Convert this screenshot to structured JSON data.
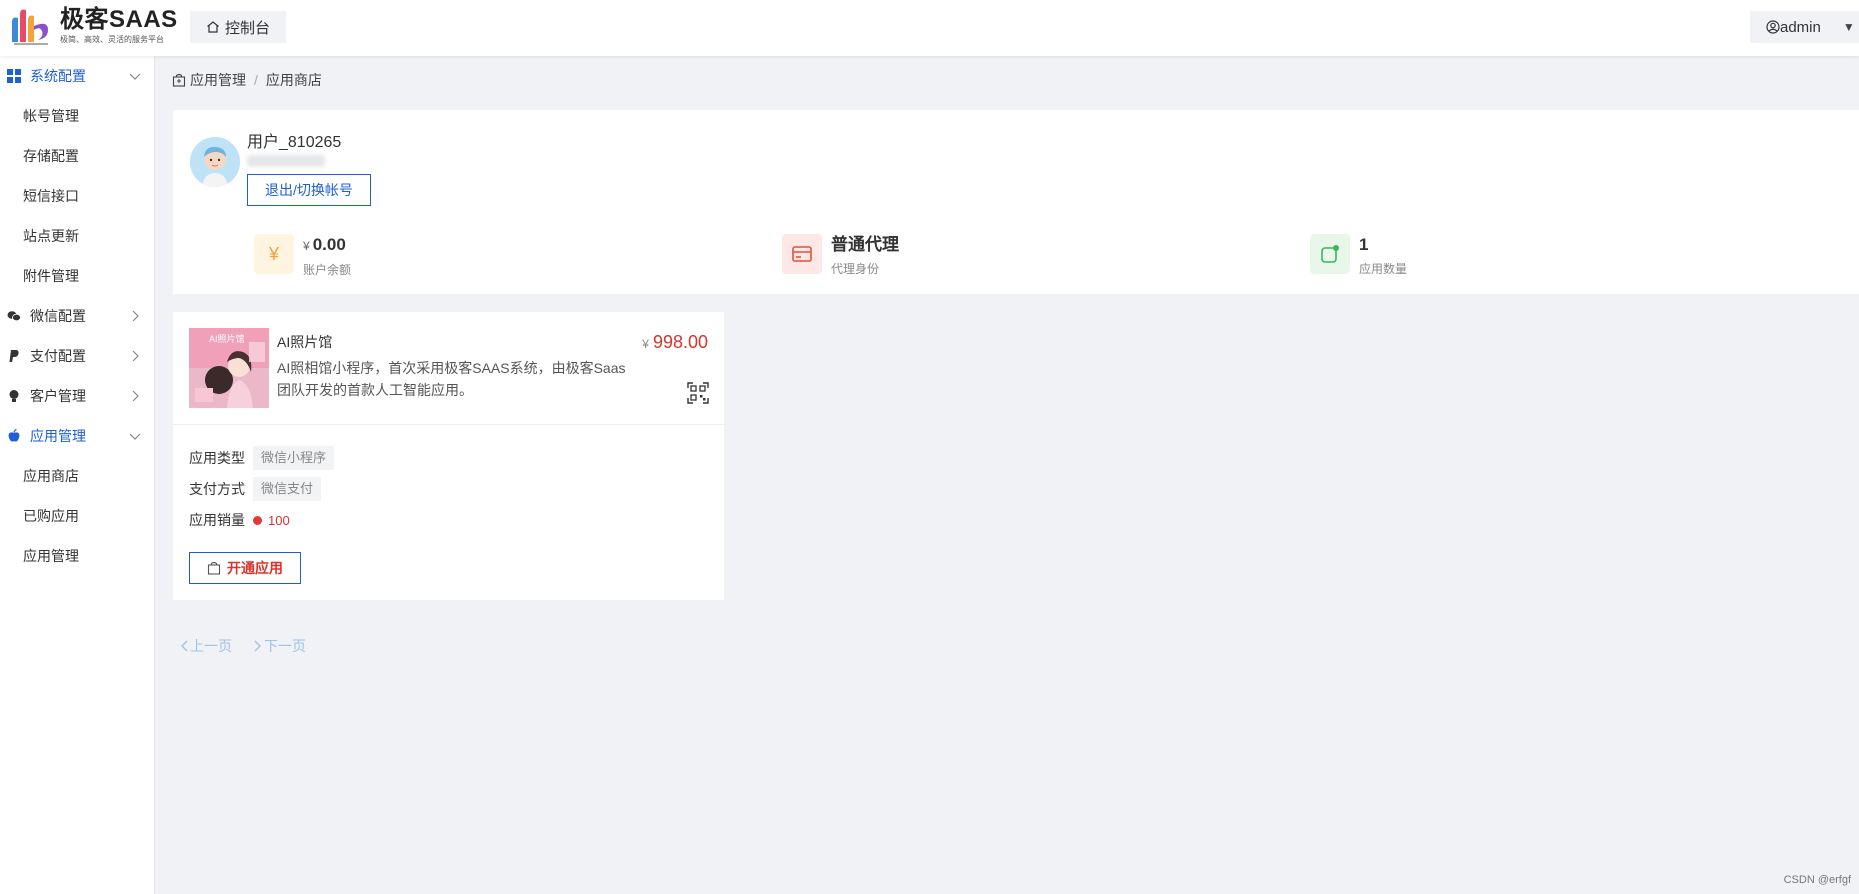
{
  "header": {
    "logo_title": "极客SAAS",
    "logo_subtitle": "极简、高效、灵活的服务平台",
    "console_label": "控制台",
    "user_label": "admin"
  },
  "sidebar": {
    "groups": [
      {
        "label": "系统配置",
        "expanded": true,
        "children": [
          "帐号管理",
          "存储配置",
          "短信接口",
          "站点更新",
          "附件管理"
        ]
      },
      {
        "label": "微信配置",
        "expanded": false
      },
      {
        "label": "支付配置",
        "expanded": false
      },
      {
        "label": "客户管理",
        "expanded": false
      },
      {
        "label": "应用管理",
        "expanded": true,
        "children": [
          "应用商店",
          "已购应用",
          "应用管理"
        ]
      }
    ]
  },
  "breadcrumb": {
    "parent": "应用管理",
    "current": "应用商店"
  },
  "profile": {
    "username": "用户_810265",
    "logout_label": "退出/切换帐号",
    "stats": [
      {
        "currency": "¥",
        "value": "0.00",
        "label": "账户余额"
      },
      {
        "value": "普通代理",
        "label": "代理身份"
      },
      {
        "value": "1",
        "label": "应用数量"
      }
    ]
  },
  "app": {
    "thumb_caption": "AI照片馆",
    "name": "AI照片馆",
    "description": "AI照相馆小程序，首次采用极客SAAS系统，由极客Saas团队开发的首款人工智能应用。",
    "price_currency": "¥",
    "price": "998.00",
    "type_label": "应用类型",
    "type_value": "微信小程序",
    "pay_label": "支付方式",
    "pay_value": "微信支付",
    "sales_label": "应用销量",
    "sales_value": "100",
    "open_label": "开通应用"
  },
  "pager": {
    "prev": "上一页",
    "next": "下一页"
  },
  "watermark": "CSDN @erfgf",
  "colors": {
    "accent": "#1f5fd6",
    "price": "#d9342b",
    "background": "#f0f2f5"
  }
}
